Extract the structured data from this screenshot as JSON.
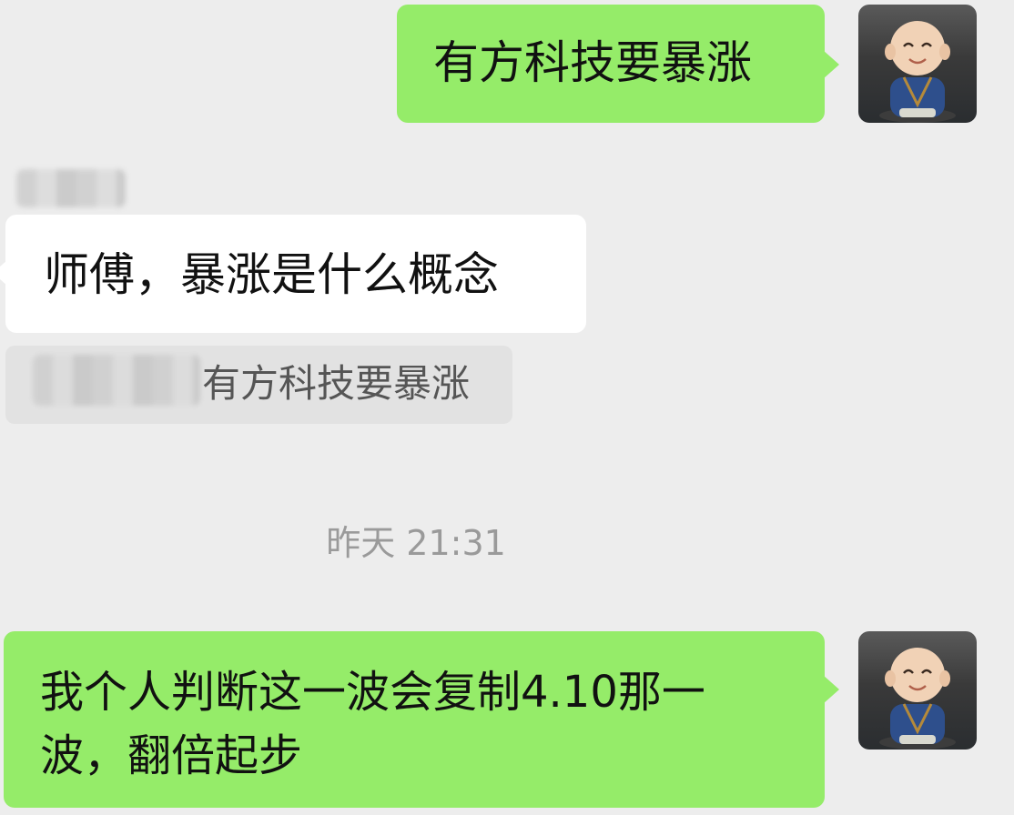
{
  "messages": [
    {
      "side": "right",
      "text": "有方科技要暴涨"
    },
    {
      "side": "left",
      "text": "师傅，暴涨是什么概念",
      "quote": "有方科技要暴涨"
    },
    {
      "side": "right",
      "text": "我个人判断这一波会复制4.10那一波，翻倍起步"
    }
  ],
  "timestamp": "昨天 21:31",
  "colors": {
    "background": "#ededed",
    "sent_bubble": "#95ec69",
    "received_bubble": "#ffffff",
    "quote_bg": "#e2e2e2"
  },
  "icons": {
    "avatar": "monk-figurine-avatar-icon"
  }
}
